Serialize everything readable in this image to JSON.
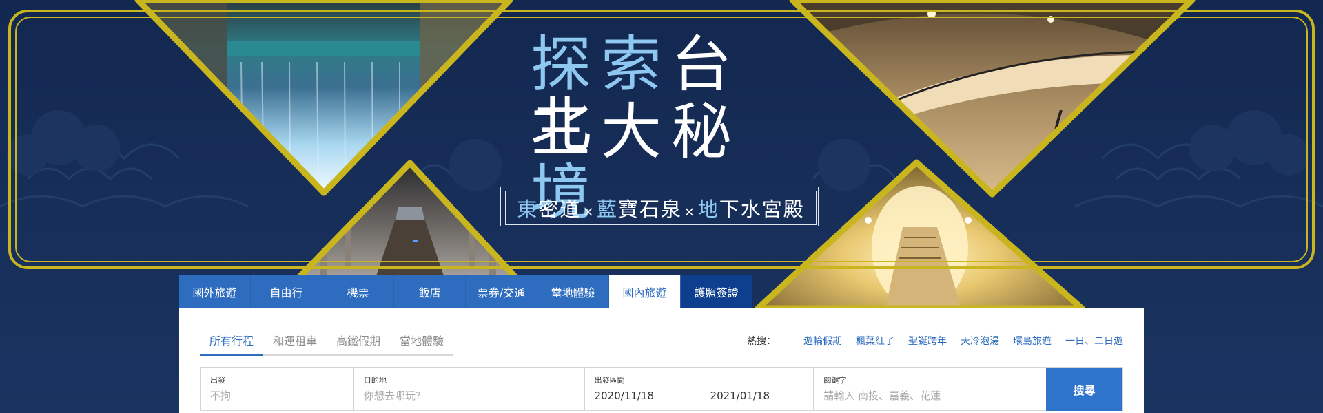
{
  "hero": {
    "title_line1": "探索台北",
    "title_line2": "三大秘境",
    "subtitle_parts": [
      "東",
      "密道",
      "×",
      "藍",
      "寶石泉",
      "×",
      "地",
      "下水宮殿"
    ]
  },
  "main_tabs": [
    {
      "label": "國外旅遊"
    },
    {
      "label": "自由行"
    },
    {
      "label": "機票"
    },
    {
      "label": "飯店"
    },
    {
      "label": "票券/交通"
    },
    {
      "label": "當地體驗"
    },
    {
      "label": "國內旅遊",
      "active": true
    },
    {
      "label": "護照簽證"
    }
  ],
  "sub_tabs": [
    {
      "label": "所有行程",
      "active": true
    },
    {
      "label": "和運租車"
    },
    {
      "label": "高鐵假期"
    },
    {
      "label": "當地體驗"
    }
  ],
  "hot": {
    "label": "熱搜：",
    "links": [
      "遊輪假期",
      "楓葉紅了",
      "聖誕跨年",
      "天冷泡湯",
      "環島旅遊",
      "一日、二日遊"
    ]
  },
  "search": {
    "from": {
      "label": "出發",
      "placeholder": "不拘"
    },
    "dest": {
      "label": "目的地",
      "placeholder": "你想去哪玩?"
    },
    "dates": {
      "label": "出發區間",
      "start": "2020/11/18",
      "end": "2021/01/18"
    },
    "keyword": {
      "label": "關鍵字",
      "placeholder": "請輸入 南投、嘉義、花蓮"
    },
    "button": "搜尋"
  },
  "colors": {
    "navy": "#132a50",
    "gold": "#c9b51d",
    "accent_blue": "#2e6cbf",
    "title_blue": "#8ec7ef"
  }
}
